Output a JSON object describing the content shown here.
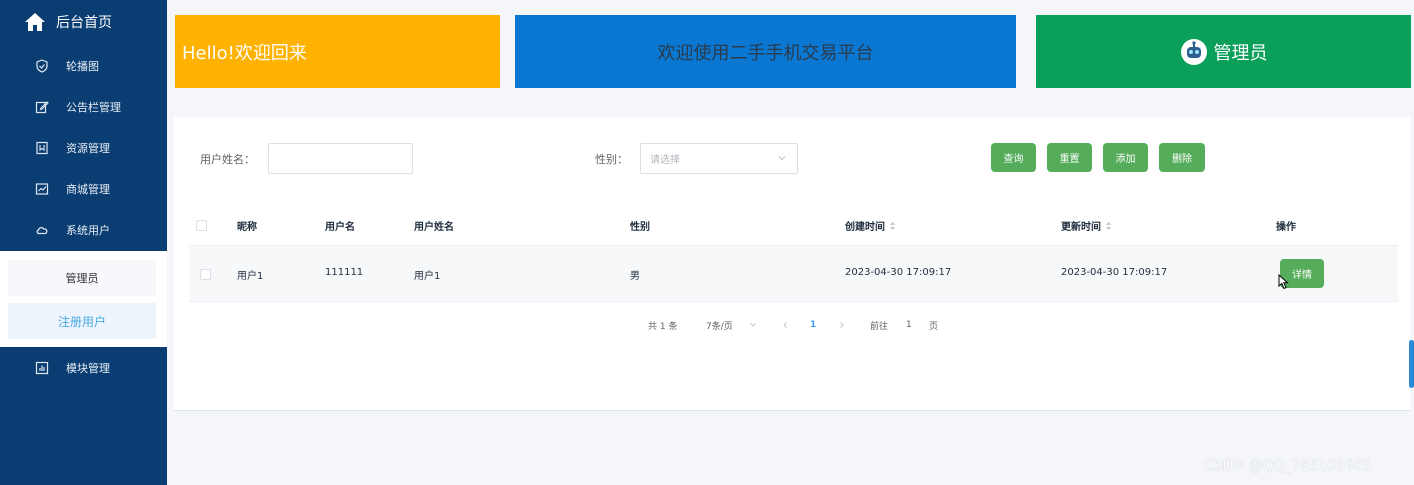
{
  "sidebar": {
    "home_label": "后台首页",
    "items": [
      {
        "label": "轮播图",
        "icon": "shield-check-icon"
      },
      {
        "label": "公告栏管理",
        "icon": "edit-icon"
      },
      {
        "label": "资源管理",
        "icon": "bookmark-icon"
      },
      {
        "label": "商城管理",
        "icon": "chart-icon"
      },
      {
        "label": "系统用户",
        "icon": "cloud-icon"
      },
      {
        "label": "模块管理",
        "icon": "bar-chart-icon"
      }
    ],
    "sub_items": [
      {
        "label": "管理员"
      },
      {
        "label": "注册用户"
      }
    ]
  },
  "cards": {
    "welcome": "Hello!欢迎回来",
    "platform": "欢迎使用二手手机交易平台",
    "user_role": "管理员"
  },
  "search": {
    "name_label": "用户姓名：",
    "name_value": "",
    "gender_label": "性别：",
    "gender_placeholder": "请选择",
    "buttons": [
      "查询",
      "重置",
      "添加",
      "删除"
    ]
  },
  "table": {
    "columns": [
      "昵称",
      "用户名",
      "用户姓名",
      "性别",
      "创建时间",
      "更新时间",
      "操作"
    ],
    "rows": [
      {
        "nickname": "用户1",
        "username": "111111",
        "realname": "用户1",
        "gender": "男",
        "created": "2023-04-30 17:09:17",
        "updated": "2023-04-30 17:09:17",
        "action": "详情"
      }
    ]
  },
  "pagination": {
    "total": "共 1 条",
    "page_size": "7条/页",
    "current_page": "1",
    "goto_label": "前往",
    "goto_value": "1",
    "page_suffix": "页"
  },
  "watermark": "CSDN @QQ_785101605",
  "colors": {
    "sidebar": "#0a3d72",
    "accent_yellow": "#ffb200",
    "accent_blue": "#0a78d2",
    "accent_green": "#0aa05a",
    "button_green": "#55ac5a",
    "link_blue": "#409eff"
  }
}
